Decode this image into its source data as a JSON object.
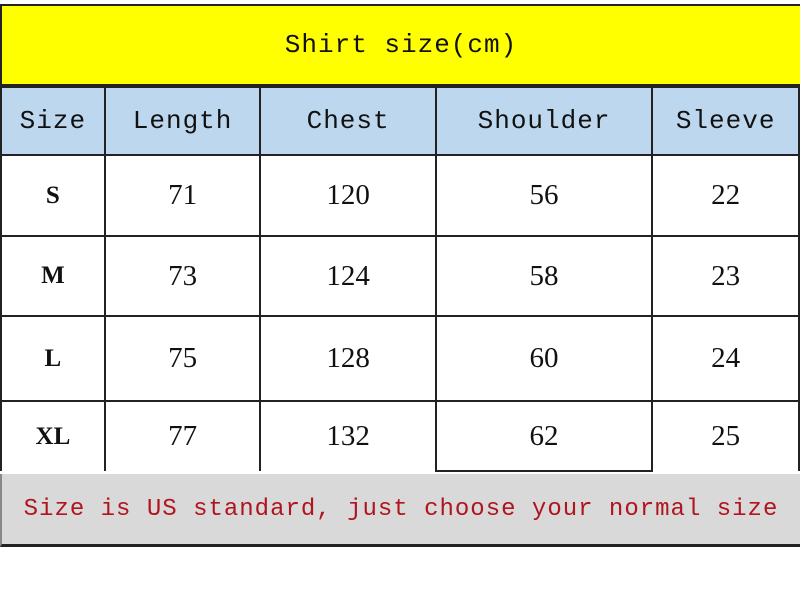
{
  "title": "Shirt size(cm)",
  "colors": {
    "title_bg": "#ffff00",
    "header_bg": "#bdd7ee",
    "note_bg": "#d9d9d9",
    "note_text": "#b0141e"
  },
  "table": {
    "headers": [
      "Size",
      "Length",
      "Chest",
      "Shoulder",
      "Sleeve"
    ],
    "rows": [
      [
        "S",
        "71",
        "120",
        "56",
        "22"
      ],
      [
        "M",
        "73",
        "124",
        "58",
        "23"
      ],
      [
        "L",
        "75",
        "128",
        "60",
        "24"
      ],
      [
        "XL",
        "77",
        "132",
        "62",
        "25"
      ]
    ]
  },
  "note": "Size is US standard, just choose your normal size"
}
